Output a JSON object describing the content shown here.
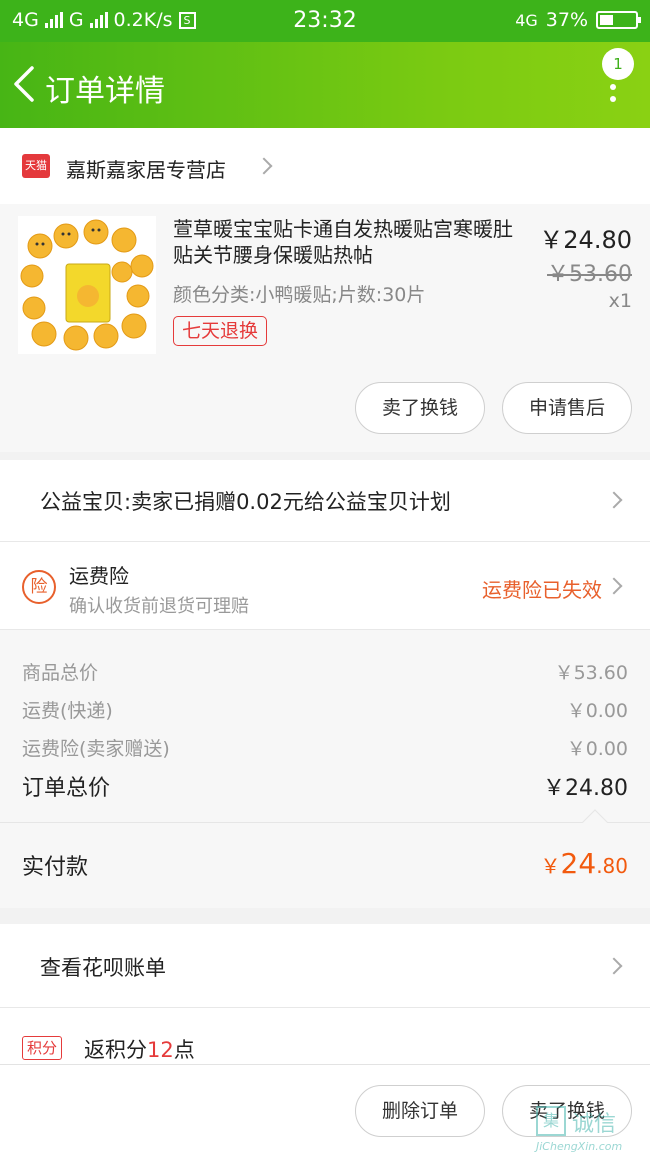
{
  "status_bar": {
    "network1": "4G",
    "network2": "G",
    "speed": "0.2K/s",
    "time": "23:32",
    "network3": "4G",
    "battery": "37%"
  },
  "nav": {
    "title": "订单详情",
    "badge": "1"
  },
  "shop": {
    "platform_badge": "天猫",
    "name": "嘉斯嘉家居专营店"
  },
  "product": {
    "title": "萱草暖宝宝贴卡通自发热暖贴宫寒暖肚贴关节腰身保暖贴热帖",
    "attributes": "颜色分类:小鸭暖贴;片数:30片",
    "tag": "七天退换",
    "price": "￥24.80",
    "original_price": "￥53.60",
    "quantity": "x1",
    "btn_sell": "卖了换钱",
    "btn_aftersale": "申请售后"
  },
  "charity": {
    "text": "公益宝贝:卖家已捐赠0.02元给公益宝贝计划"
  },
  "insurance": {
    "icon_text": "险",
    "title": "运费险",
    "subtitle": "确认收货前退货可理赔",
    "status": "运费险已失效"
  },
  "fees": {
    "items_label": "商品总价",
    "items_value": "￥53.60",
    "shipping_label": "运费(快递)",
    "shipping_value": "￥0.00",
    "insurance_label": "运费险(卖家赠送)",
    "insurance_value": "￥0.00",
    "total_label": "订单总价",
    "total_value": "￥24.80"
  },
  "paid": {
    "label": "实付款",
    "currency": "￥",
    "int_part": "24",
    "dec_part": ".80"
  },
  "huabei": {
    "text": "查看花呗账单"
  },
  "points": {
    "tag": "积分",
    "prefix": "返积分",
    "count": "12",
    "suffix": "点"
  },
  "bottom": {
    "btn_delete": "删除订单",
    "btn_sell": "卖了换钱"
  },
  "watermark": {
    "logo": "集",
    "text": "诚信",
    "url": "JiChengXin.com"
  },
  "colors": {
    "brand_green": "#3db31a",
    "orange": "#e8602c",
    "red": "#e53b3b"
  }
}
